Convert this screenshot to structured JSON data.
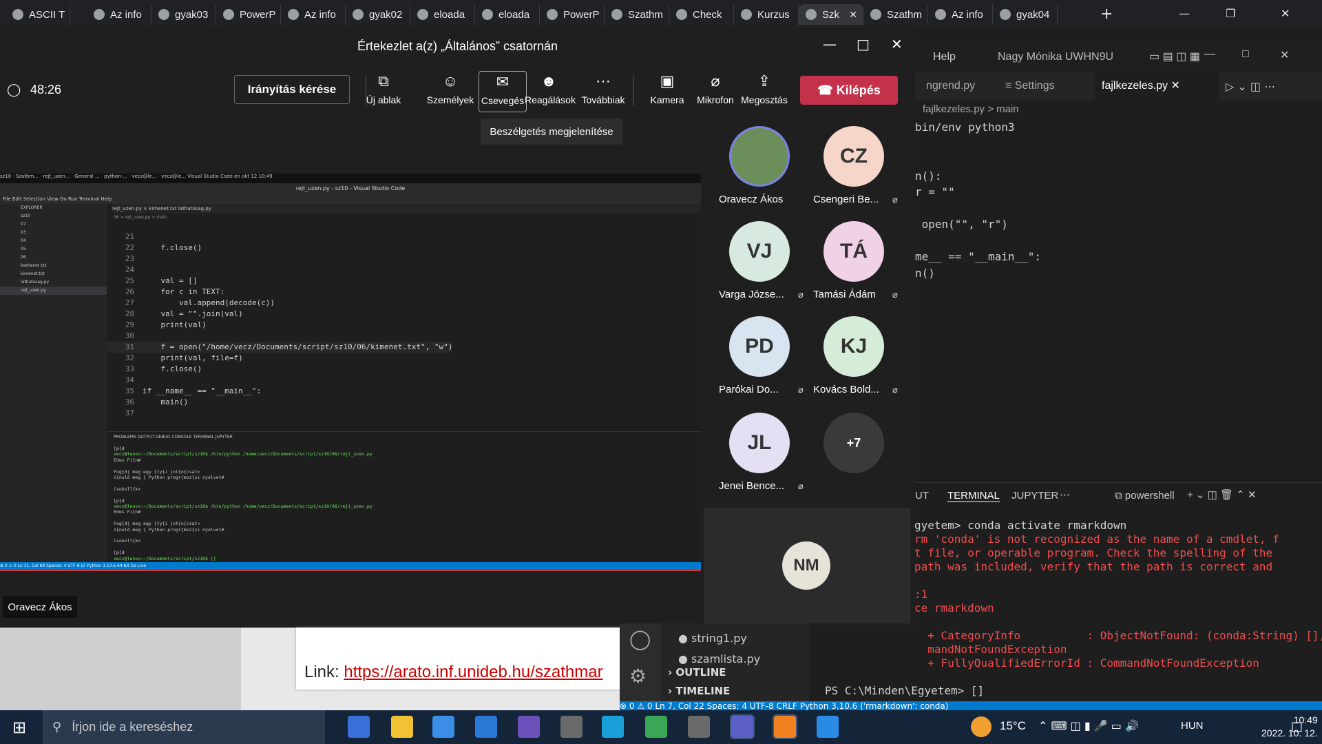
{
  "browser": {
    "tabs": [
      {
        "label": "ASCII T"
      },
      {
        "label": "Az info"
      },
      {
        "label": "gyak03"
      },
      {
        "label": "PowerP"
      },
      {
        "label": "Az info"
      },
      {
        "label": "gyak02"
      },
      {
        "label": "eloada"
      },
      {
        "label": "eloada"
      },
      {
        "label": "PowerP"
      },
      {
        "label": "Szathm"
      },
      {
        "label": "Check"
      },
      {
        "label": "Kurzus"
      },
      {
        "label": "Szk"
      },
      {
        "label": "Szathm"
      },
      {
        "label": "Az info"
      },
      {
        "label": "gyak04"
      }
    ],
    "new_tab": "+"
  },
  "teams": {
    "title": "Értekezlet a(z) „Általános” csatornán",
    "timer": "48:26",
    "control_request": "Irányítás kérése",
    "toolbar": [
      {
        "label": "Új ablak",
        "icon": "popout-icon"
      },
      {
        "label": "Személyek",
        "icon": "people-icon"
      },
      {
        "label": "Csevegés",
        "icon": "chat-icon"
      },
      {
        "label": "Reagálások",
        "icon": "reactions-icon"
      },
      {
        "label": "Továbbiak",
        "icon": "more-icon"
      },
      {
        "label": "Kamera",
        "icon": "camera-off-icon"
      },
      {
        "label": "Mikrofon",
        "icon": "mic-off-icon"
      },
      {
        "label": "Megosztás",
        "icon": "share-icon"
      }
    ],
    "leave": "Kilépés",
    "tooltip": "Beszélgetés megjelenítése",
    "participants": [
      {
        "initials": "",
        "name": "Oravecz Ákos",
        "muted": false,
        "color": "#6b8e5a"
      },
      {
        "initials": "CZ",
        "name": "Csengeri Be...",
        "muted": true,
        "color": "#f5d6c8"
      },
      {
        "initials": "VJ",
        "name": "Varga Józse...",
        "muted": true,
        "color": "#d8eadf"
      },
      {
        "initials": "TÁ",
        "name": "Tamási Ádám",
        "muted": true,
        "color": "#f0d1e6"
      },
      {
        "initials": "PD",
        "name": "Parókai Do...",
        "muted": true,
        "color": "#d8e4ef"
      },
      {
        "initials": "KJ",
        "name": "Kovács Bold...",
        "muted": true,
        "color": "#d5ecd9"
      },
      {
        "initials": "JL",
        "name": "Jenei Bence...",
        "muted": true,
        "color": "#e4dff2"
      },
      {
        "initials": "+7",
        "name": "",
        "muted": false,
        "color": "#3a3a3a"
      }
    ],
    "self": {
      "initials": "NM"
    },
    "presenter_tag": "Oravecz Ákos"
  },
  "shared": {
    "topbar": "sz10 · Szathm... · rejt_uzen... · General ... · python-... · vecz@le... · vecz@le...     Visual Studio Code     en  okt 12 10:49",
    "title": "rejt_uzen.py - sz10 - Visual Studio Code",
    "menu": "File  Edit  Selection  View  Go  Run  Terminal  Help",
    "tabs": "rejt_uzen.py ×     kimenet.txt     lathatosag.py",
    "breadcrumb": "06 > rejt_uzen.py > main",
    "explorer": [
      "EXPLORER",
      "sz10",
      "07",
      "03",
      "04",
      "05",
      "06",
      "barbanet.txt",
      "kimenet.txt",
      "lathatosag.py",
      "rejt_uzen.py"
    ],
    "code": [
      {
        "n": "21",
        "t": ""
      },
      {
        "n": "22",
        "t": "    f.close()"
      },
      {
        "n": "23",
        "t": ""
      },
      {
        "n": "24",
        "t": ""
      },
      {
        "n": "25",
        "t": "    val = []"
      },
      {
        "n": "26",
        "t": "    for c in TEXT:"
      },
      {
        "n": "27",
        "t": "        val.append(decode(c))"
      },
      {
        "n": "28",
        "t": "    val = \"\".join(val)"
      },
      {
        "n": "29",
        "t": "    print(val)"
      },
      {
        "n": "30",
        "t": ""
      },
      {
        "n": "31",
        "t": "    f = open(\"/home/vecz/Documents/script/sz10/06/kimenet.txt\", \"w\")"
      },
      {
        "n": "32",
        "t": "    print(val, file=f)"
      },
      {
        "n": "33",
        "t": "    f.close()"
      },
      {
        "n": "34",
        "t": ""
      },
      {
        "n": "35",
        "t": "if __name__ == \"__main__\":"
      },
      {
        "n": "36",
        "t": "    main()"
      },
      {
        "n": "37",
        "t": ""
      }
    ],
    "panel_tabs": "PROBLEMS   OUTPUT   DEBUG CONSOLE   TERMINAL   JUPYTER",
    "terminal": [
      "[p{d",
      "vecz@lenvo:~/Documents/script/sz10$ /bin/python /home/vecz/Documents/script/sz10/06/rejt_uzen.py",
      "Edes Fi{n#",
      "",
      "Fog{dj meg egy {ty{i jot{n{csat<",
      "í{nuld meg { Python progr{moz{si nyelvet#",
      "",
      "Csokoll{k<",
      "",
      "[p{d",
      "vecz@lenvo:~/Documents/script/sz10$ /bin/python /home/vecz/Documents/script/sz10/06/rejt_uzen.py",
      "Edes Fi{n#",
      "",
      "Fog{dj meg egy {ty{i jot{n{csat<",
      "í{nuld meg { Python progr{moz{si nyelvet#",
      "",
      "Csokoll{k<",
      "",
      "[p{d",
      "vecz@lenvo:~/Documents/script/sz10$ []"
    ],
    "status": "⊗ 0 ⚠ 0                                                                                                                        Ln 31, Col 69   Spaces: 4   UTF-8   LF   Python   3.10.6 64-bit   Go Live"
  },
  "vscode": {
    "menu_help": "Help",
    "account": "Nagy Mónika UWHN9U",
    "tabs": [
      "ngrend.py",
      "Settings",
      "fajlkezeles.py"
    ],
    "breadcrumb": "fajlkezeles.py > main",
    "code": [
      "bin/env python3",
      "",
      "",
      "n():",
      "r = \"\"",
      "",
      " open(\"\", \"r\")",
      "",
      "me__ == \"__main__\":",
      "n()"
    ],
    "term_tabs": [
      "UT",
      "TERMINAL",
      "JUPYTER"
    ],
    "shell": "powershell",
    "term": [
      {
        "t": "gyetem> conda activate rmarkdown",
        "c": "#d4d4d4"
      },
      {
        "t": "rm 'conda' is not recognized as the name of a cmdlet, f",
        "c": "#f14c4c"
      },
      {
        "t": "t file, or operable program. Check the spelling of the",
        "c": "#f14c4c"
      },
      {
        "t": "path was included, verify that the path is correct and",
        "c": "#f14c4c"
      },
      {
        "t": "",
        "c": "#f14c4c"
      },
      {
        "t": ":1",
        "c": "#f14c4c"
      },
      {
        "t": "ce rmarkdown",
        "c": "#f14c4c"
      },
      {
        "t": "",
        "c": "#f14c4c"
      },
      {
        "t": "  + CategoryInfo          : ObjectNotFound: (conda:String) [], Com",
        "c": "#f14c4c"
      },
      {
        "t": "  mandNotFoundException",
        "c": "#f14c4c"
      },
      {
        "t": "  + FullyQualifiedErrorId : CommandNotFoundException",
        "c": "#f14c4c"
      },
      {
        "t": "",
        "c": "#f14c4c"
      },
      {
        "t": "PS C:\\Minden\\Egyetem> []",
        "c": "#d4d4d4"
      }
    ],
    "left_files": [
      "string1.py",
      "szamlista.py"
    ],
    "outline": "OUTLINE",
    "timeline": "TIMELINE",
    "status": "⊗ 0 ⚠ 0                                                          Ln 7, Col 22   Spaces: 4   UTF-8   CRLF   Python   3.10.6 ('rmarkdown': conda)"
  },
  "slide": {
    "link_label": "Link:",
    "link_url": "https://arato.inf.unideb.hu/szathmar"
  },
  "taskbar": {
    "search_placeholder": "Írjon ide a kereséshez",
    "temp": "15°C",
    "lang": "HUN",
    "time": "10:49",
    "date": "2022. 10. 12."
  }
}
